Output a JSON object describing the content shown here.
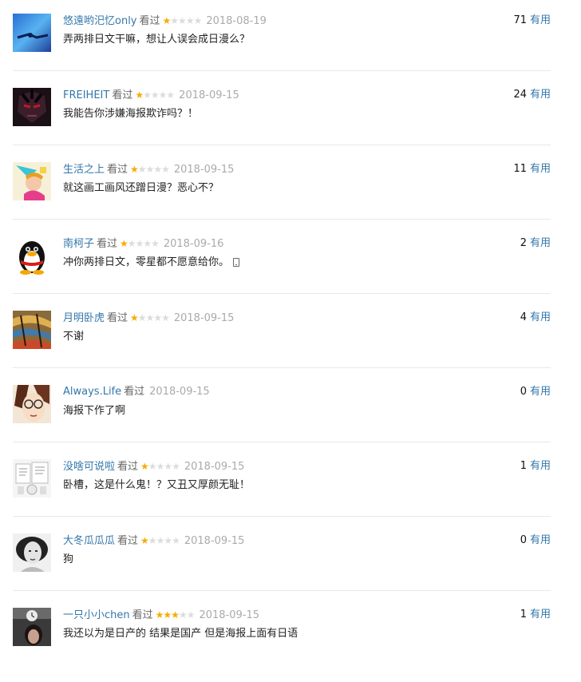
{
  "comments": [
    {
      "user": "悠遠哟汜忆only",
      "status": "看过",
      "rating": 1,
      "date": "2018-08-19",
      "votes": "71",
      "useful_label": "有用",
      "text": "弄两排日文干嘛，想让人误会成日漫么？"
    },
    {
      "user": "FREIHEIT",
      "status": "看过",
      "rating": 1,
      "date": "2018-09-15",
      "votes": "24",
      "useful_label": "有用",
      "text": "我能告你涉嫌海报欺诈吗？！"
    },
    {
      "user": "生活之上",
      "status": "看过",
      "rating": 1,
      "date": "2018-09-15",
      "votes": "11",
      "useful_label": "有用",
      "text": "就这画工画风还蹭日漫？恶心不？"
    },
    {
      "user": "南柯子",
      "status": "看过",
      "rating": 1,
      "date": "2018-09-16",
      "votes": "2",
      "useful_label": "有用",
      "text": "冲你两排日文，零星都不愿意给你。"
    },
    {
      "user": "月明卧虎",
      "status": "看过",
      "rating": 1,
      "date": "2018-09-15",
      "votes": "4",
      "useful_label": "有用",
      "text": "不谢"
    },
    {
      "user": "Always.Life",
      "status": "看过",
      "rating": 0,
      "date": "2018-09-15",
      "votes": "0",
      "useful_label": "有用",
      "text": "海报下作了啊"
    },
    {
      "user": "没啥可说啦",
      "status": "看过",
      "rating": 1,
      "date": "2018-09-15",
      "votes": "1",
      "useful_label": "有用",
      "text": "卧槽，这是什么鬼！？又丑又厚颜无耻！"
    },
    {
      "user": "大冬瓜瓜瓜",
      "status": "看过",
      "rating": 1,
      "date": "2018-09-15",
      "votes": "0",
      "useful_label": "有用",
      "text": "狗"
    },
    {
      "user": "一只小小chen",
      "status": "看过",
      "rating": 3,
      "date": "2018-09-15",
      "votes": "1",
      "useful_label": "有用",
      "text": "我还以为是日产的 结果是国产 但是海报上面有日语"
    }
  ],
  "colors": {
    "link": "#3377aa",
    "star_on": "#f6ab00",
    "star_off": "#dcdcdc",
    "date": "#aaaaaa",
    "divider": "#e8e8e8"
  }
}
